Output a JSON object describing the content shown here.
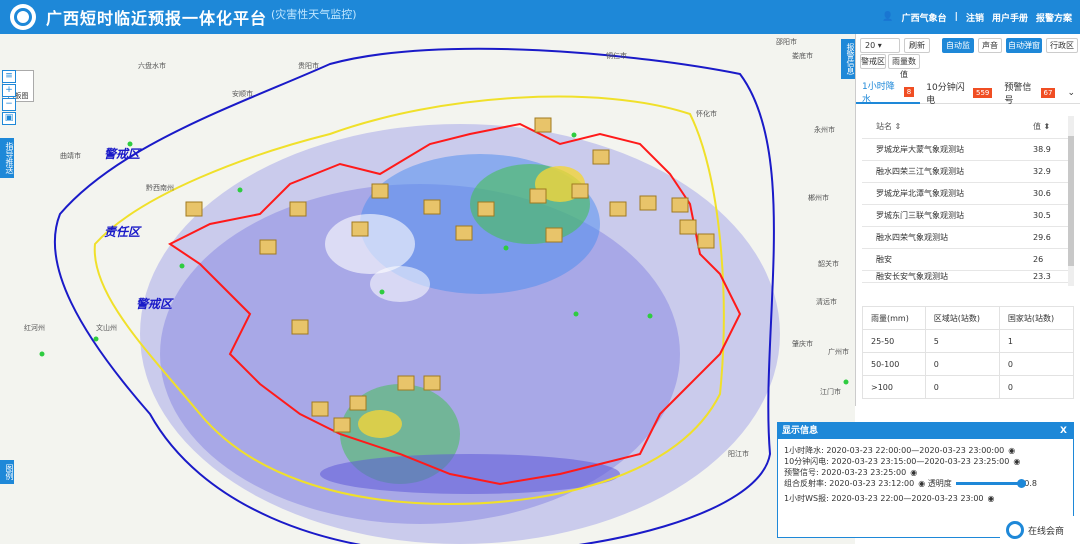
{
  "header": {
    "title": "广西短时临近预报一体化平台",
    "subtitle": "(灾害性天气监控)",
    "user": "广西气象台",
    "logout": "注销",
    "manual": "用户手册",
    "plan": "报警方案"
  },
  "left_tools": {
    "basemap": "白板图",
    "tab_guidance": "指导推送",
    "tab_legend": "图例"
  },
  "map": {
    "zones": [
      "警戒区",
      "责任区",
      "警戒区"
    ],
    "cities": [
      "六盘水市",
      "安顺市",
      "贵阳市",
      "曲靖市",
      "黔西南州",
      "文山州",
      "红河州",
      "铜仁市",
      "邵阳市",
      "娄底市",
      "怀化市",
      "永州市",
      "郴州市",
      "韶关市",
      "清远市",
      "肇庆市",
      "江门市",
      "阳江市",
      "广州市",
      "湛江市",
      "茂名市",
      "黔东南州",
      "百色市",
      "防城港市"
    ]
  },
  "panel": {
    "side_tab": "报警信息",
    "interval": "20",
    "refresh": "刷新",
    "auto_monitor": "自动监控",
    "sound": "声音",
    "auto_popup": "自动弹窗",
    "admin_area": "行政区",
    "alert_area": "警戒区",
    "rain_value": "雨量数值",
    "tabs": [
      {
        "label": "1小时降水",
        "count": "8"
      },
      {
        "label": "10分钟闪电",
        "count": "559"
      },
      {
        "label": "预警信号",
        "count": "67"
      }
    ],
    "station_header": {
      "name": "站名 ⇕",
      "value": "值 ⬍"
    },
    "stations": [
      {
        "name": "罗城龙岸大蒙气象观测站",
        "value": "38.9"
      },
      {
        "name": "融水四荣三江气象观测站",
        "value": "32.9"
      },
      {
        "name": "罗城龙岸北潭气象观测站",
        "value": "30.6"
      },
      {
        "name": "罗城东门三联气象观测站",
        "value": "30.5"
      },
      {
        "name": "融水四荣气象观测站",
        "value": "29.6"
      },
      {
        "name": "融安",
        "value": "26"
      },
      {
        "name": "融安长安气象观测站",
        "value": "23.3"
      }
    ],
    "rain_header": [
      "雨量(mm)",
      "区域站(站数)",
      "国家站(站数)"
    ],
    "rain_rows": [
      [
        "25-50",
        "5",
        "1"
      ],
      [
        "50-100",
        "0",
        "0"
      ],
      [
        ">100",
        "0",
        "0"
      ]
    ]
  },
  "info": {
    "title": "显示信息",
    "close": "X",
    "rows": [
      "1小时降水: 2020-03-23 22:00:00—2020-03-23 23:00:00",
      "10分钟闪电: 2020-03-23 23:15:00—2020-03-23 23:25:00",
      "预警信号: 2020-03-23 23:25:00",
      "组合反射率: 2020-03-23 23:12:00",
      "1小时WS报: 2020-03-23 22:00—2020-03-23 23:00"
    ],
    "opacity_label": "透明度",
    "opacity_value": "0.8"
  },
  "consult": "在线会商",
  "colors": {
    "accent": "#1e88d8",
    "border_red": "#ff1a1a",
    "alert_count": "#f04e23"
  }
}
